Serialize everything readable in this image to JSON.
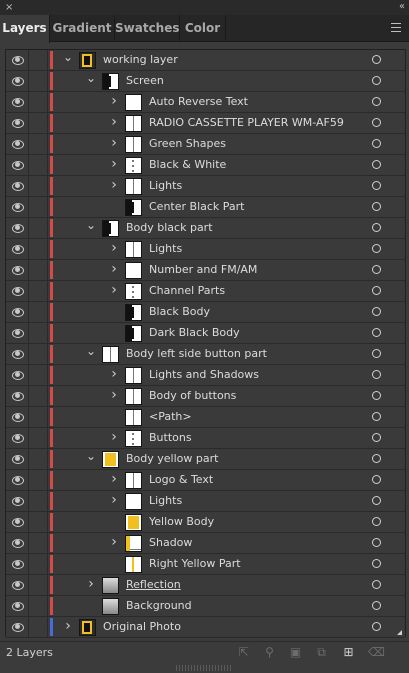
{
  "panel": {
    "close_glyph": "×",
    "collapse_glyph": "‹‹",
    "tabs": [
      {
        "label": "Layers",
        "active": true
      },
      {
        "label": "Gradient",
        "active": false
      },
      {
        "label": "Swatches",
        "active": false
      },
      {
        "label": "Color",
        "active": false
      }
    ]
  },
  "layers": [
    {
      "name": "working layer",
      "level": 0,
      "expanded": true,
      "has_children": true,
      "thumb": "mixed",
      "color": "#d24a4a"
    },
    {
      "name": "Screen",
      "level": 1,
      "expanded": true,
      "has_children": true,
      "thumb": "black-left",
      "color": "#d24a4a"
    },
    {
      "name": "Auto Reverse Text",
      "level": 2,
      "expanded": false,
      "has_children": true,
      "thumb": "white",
      "color": "#d24a4a"
    },
    {
      "name": "RADIO CASSETTE PLAYER WM-AF59",
      "level": 2,
      "expanded": false,
      "has_children": true,
      "thumb": "line",
      "color": "#d24a4a"
    },
    {
      "name": "Green Shapes",
      "level": 2,
      "expanded": false,
      "has_children": true,
      "thumb": "line",
      "color": "#d24a4a"
    },
    {
      "name": "Black & White",
      "level": 2,
      "expanded": false,
      "has_children": true,
      "thumb": "dots",
      "color": "#d24a4a"
    },
    {
      "name": "Lights",
      "level": 2,
      "expanded": false,
      "has_children": true,
      "thumb": "line",
      "color": "#d24a4a"
    },
    {
      "name": "Center Black Part",
      "level": 2,
      "expanded": false,
      "has_children": false,
      "thumb": "black-left",
      "color": "#d24a4a"
    },
    {
      "name": "Body black part",
      "level": 1,
      "expanded": true,
      "has_children": true,
      "thumb": "black-left",
      "color": "#d24a4a"
    },
    {
      "name": "Lights",
      "level": 2,
      "expanded": false,
      "has_children": true,
      "thumb": "line",
      "color": "#d24a4a"
    },
    {
      "name": "Number and FM/AM",
      "level": 2,
      "expanded": false,
      "has_children": true,
      "thumb": "white",
      "color": "#d24a4a"
    },
    {
      "name": "Channel Parts",
      "level": 2,
      "expanded": false,
      "has_children": true,
      "thumb": "dots",
      "color": "#d24a4a"
    },
    {
      "name": "Black Body",
      "level": 2,
      "expanded": false,
      "has_children": false,
      "thumb": "black-left",
      "color": "#d24a4a"
    },
    {
      "name": "Dark Black Body",
      "level": 2,
      "expanded": false,
      "has_children": false,
      "thumb": "black-left",
      "color": "#d24a4a"
    },
    {
      "name": "Body left side button part",
      "level": 1,
      "expanded": true,
      "has_children": true,
      "thumb": "line",
      "color": "#d24a4a"
    },
    {
      "name": "Lights and Shadows",
      "level": 2,
      "expanded": false,
      "has_children": true,
      "thumb": "line",
      "color": "#d24a4a"
    },
    {
      "name": "Body of buttons",
      "level": 2,
      "expanded": false,
      "has_children": true,
      "thumb": "line",
      "color": "#d24a4a"
    },
    {
      "name": "<Path>",
      "level": 2,
      "expanded": false,
      "has_children": false,
      "thumb": "line",
      "color": "#d24a4a"
    },
    {
      "name": "Buttons",
      "level": 2,
      "expanded": false,
      "has_children": true,
      "thumb": "dots",
      "color": "#d24a4a"
    },
    {
      "name": "Body yellow part",
      "level": 1,
      "expanded": true,
      "has_children": true,
      "thumb": "yellow",
      "color": "#d24a4a"
    },
    {
      "name": "Logo & Text",
      "level": 2,
      "expanded": false,
      "has_children": true,
      "thumb": "line",
      "color": "#d24a4a"
    },
    {
      "name": "Lights",
      "level": 2,
      "expanded": false,
      "has_children": true,
      "thumb": "white",
      "color": "#d24a4a"
    },
    {
      "name": "Yellow Body",
      "level": 2,
      "expanded": false,
      "has_children": false,
      "thumb": "yellow",
      "color": "#d24a4a"
    },
    {
      "name": "Shadow",
      "level": 2,
      "expanded": false,
      "has_children": true,
      "thumb": "yellow-left",
      "color": "#d24a4a"
    },
    {
      "name": "Right Yellow Part",
      "level": 2,
      "expanded": false,
      "has_children": false,
      "thumb": "yellow-line",
      "color": "#d24a4a"
    },
    {
      "name": "Reflection",
      "level": 1,
      "expanded": false,
      "has_children": true,
      "thumb": "gray",
      "color": "#d24a4a",
      "underlined": true
    },
    {
      "name": "Background",
      "level": 1,
      "expanded": false,
      "has_children": false,
      "thumb": "gray",
      "color": "#d24a4a"
    },
    {
      "name": "Original Photo",
      "level": 0,
      "expanded": false,
      "has_children": true,
      "thumb": "mixed",
      "color": "#4a6ad8"
    }
  ],
  "footer": {
    "count_label": "2 Layers",
    "icons": [
      "export-icon",
      "locate-object-icon",
      "clipping-mask-icon",
      "new-sublayer-icon",
      "new-layer-icon",
      "delete-icon"
    ]
  }
}
